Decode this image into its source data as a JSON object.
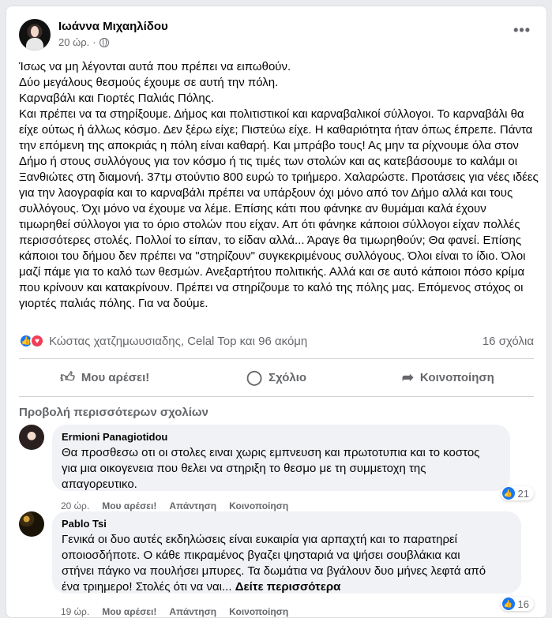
{
  "post": {
    "author": "Ιωάννα Μιχαηλίδου",
    "time": "20 ώρ.",
    "separator": "·",
    "text": "Ίσως να μη λέγονται αυτά που πρέπει να ειπωθούν.\nΔύο μεγάλους θεσμούς έχουμε σε αυτή την πόλη.\nΚαρναβάλι και Γιορτές Παλιάς Πόλης.\nΚαι πρέπει να τα στηρίξουμε. Δήμος και πολιτιστικοί και καρναβαλικοί σύλλογοι. Το καρναβάλι θα είχε ούτως ή άλλως κόσμο. Δεν ξέρω είχε; Πιστεύω είχε. Η καθαριότητα ήταν όπως έπρεπε. Πάντα την επόμενη της αποκριάς η πόλη είναι καθαρή. Και μπράβο τους! Ας μην τα ρίχνουμε όλα στον Δήμο ή στους συλλόγους για τον κόσμο ή τις τιμές των στολών και ας κατεβάσουμε το καλάμι οι Ξανθιώτες στη διαμονή. 37τμ στούντιο 800 ευρώ το τριήμερο. Χαλαρώστε. Προτάσεις για νέες ιδέες για την λαογραφία και το καρναβάλι πρέπει να υπάρξουν όχι μόνο από τον Δήμο αλλά και τους συλλόγους. Όχι μόνο να έχουμε να λέμε. Επίσης κάτι που φάνηκε αν θυμάμαι καλά έχουν τιμωρηθεί σύλλογοι για το όριο στολών που είχαν. Απ ότι φάνηκε κάποιοι σύλλογοι είχαν πολλές περισσότερες στολές. Πολλοί το είπαν, το είδαν αλλά... Άραγε θα τιμωρηθούν; Θα φανεί. Επίσης κάποιοι του δήμου δεν πρέπει να \"στηρίζουν\" συγκεκριμένους συλλόγους. Όλοι είναι το ίδιο. Όλοι μαζί πάμε για το καλό των θεσμών. Ανεξαρτήτου πολιτικής. Αλλά και σε αυτό κάποιοι πόσο κρίμα που κρίνουν και κατακρίνουν. Πρέπει να στηρίζουμε το καλό της πόλης μας. Επόμενος στόχος οι γιορτές παλιάς πόλης. Για να δούμε."
  },
  "reactions": {
    "names": "Κώστας χατζημωυσιαδης, Celal Top και 96 ακόμη",
    "comments_count": "16 σχόλια"
  },
  "actions": {
    "like": "Μου αρέσει!",
    "comment": "Σχόλιο",
    "share": "Κοινοποίηση"
  },
  "view_more_comments": "Προβολή περισσότερων σχολίων",
  "comments": [
    {
      "name": "Ermioni Panagiotidou",
      "text": "Θα προσθεσω οτι οι στολες ειναι χωρις εμπνευση και πρωτοτυπια και το κοστος\nγια μια οικογενεια που θελει να στηριξη το θεσμο με τη συμμετοχη της\nαπαγορευτικο.",
      "time": "20 ώρ.",
      "like": "Μου αρέσει!",
      "reply": "Απάντηση",
      "share": "Κοινοποίηση",
      "reactions": "21"
    },
    {
      "name": "Pablo Tsi",
      "text": "Γενικά οι δυο αυτές εκδηλώσεις είναι ευκαιρία για αρπαχτή και το παρατηρεί\nοποιοσδήποτε. Ο κάθε πικραμένος βγαζει ψησταριά να ψήσει σουβλάκια και\nστήνει πάγκο να πουλήσει μπυρες. Τα δωμάτια να βγάλουν δυο μήνες λεφτά από\nένα τριημερο! Στολές ότι να ναι...",
      "see_more": "Δείτε περισσότερα",
      "time": "19 ώρ.",
      "like": "Μου αρέσει!",
      "reply": "Απάντηση",
      "share": "Κοινοποίηση",
      "reactions": "16"
    }
  ],
  "colors": {
    "like_blue": "#1877f2",
    "love_red": "#f33e58",
    "muted_text": "#65676b",
    "bubble_bg": "#f0f2f5"
  },
  "icons": [
    "globe-icon",
    "more-options-icon",
    "like-reaction-icon",
    "love-reaction-icon",
    "thumbs-up-icon",
    "comment-icon",
    "share-icon"
  ]
}
